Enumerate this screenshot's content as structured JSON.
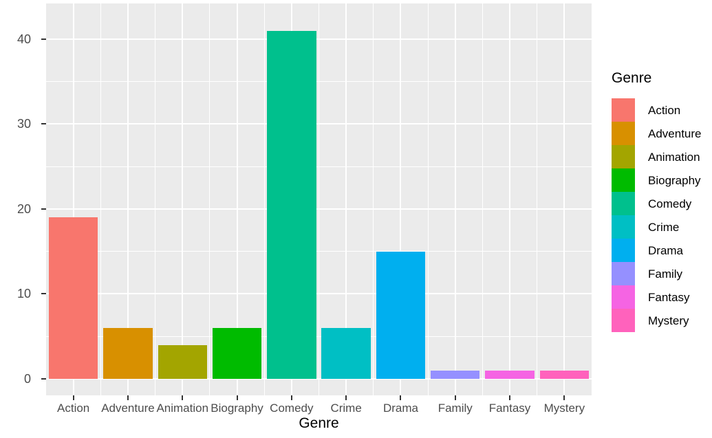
{
  "chart_data": {
    "type": "bar",
    "title": "",
    "subtitle": "",
    "xlabel": "Genre",
    "ylabel": "",
    "categories": [
      "Action",
      "Adventure",
      "Animation",
      "Biography",
      "Comedy",
      "Crime",
      "Drama",
      "Family",
      "Fantasy",
      "Mystery"
    ],
    "values": [
      19,
      6,
      4,
      6,
      41,
      6,
      15,
      1,
      1,
      1
    ],
    "colors": [
      "#f8766d",
      "#d89000",
      "#a3a500",
      "#00bb00",
      "#00c08d",
      "#00bfc4",
      "#00afef",
      "#9590ff",
      "#f564e3",
      "#ff62bc"
    ],
    "ylim": [
      0,
      44.2
    ],
    "y_ticks": [
      0,
      10,
      20,
      30,
      40
    ],
    "y_tick_labels": [
      "0",
      "10",
      "20",
      "30",
      "40"
    ],
    "y_minor_ticks": [
      5,
      15,
      25,
      35
    ],
    "grid": true,
    "legend": {
      "title": "Genre",
      "position": "right",
      "entries": [
        {
          "label": "Action",
          "color": "#f8766d"
        },
        {
          "label": "Adventure",
          "color": "#d89000"
        },
        {
          "label": "Animation",
          "color": "#a3a500"
        },
        {
          "label": "Biography",
          "color": "#00bb00"
        },
        {
          "label": "Comedy",
          "color": "#00c08d"
        },
        {
          "label": "Crime",
          "color": "#00bfc4"
        },
        {
          "label": "Drama",
          "color": "#00afef"
        },
        {
          "label": "Family",
          "color": "#9590ff"
        },
        {
          "label": "Fantasy",
          "color": "#f564e3"
        },
        {
          "label": "Mystery",
          "color": "#ff62bc"
        }
      ]
    },
    "panel_background": "#ebebeb",
    "grid_color": "#ffffff",
    "plot_background": "#ffffff"
  }
}
